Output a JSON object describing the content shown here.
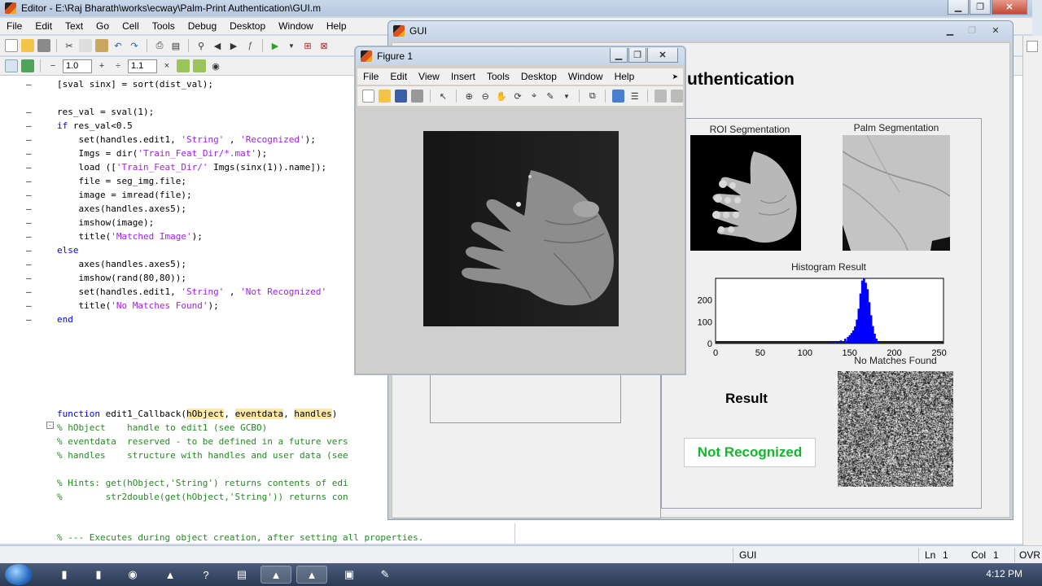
{
  "editor": {
    "title": "Editor - E:\\Raj Bharath\\works\\ecway\\Palm-Print Authentication\\GUI.m",
    "menu": [
      "File",
      "Edit",
      "Text",
      "Go",
      "Cell",
      "Tools",
      "Debug",
      "Desktop",
      "Window",
      "Help"
    ],
    "cell_minus": "−",
    "cell_value1": "1.0",
    "cell_plus": "+",
    "cell_divide": "÷",
    "cell_value2": "1.1",
    "cell_times": "×",
    "code": {
      "l1": "[sval sinx] = sort(dist_val);",
      "l2": "res_val = sval(1);",
      "l3_kw": "if",
      "l3_rest": " res_val<0.5",
      "l4_a": "    set(handles.edit1, ",
      "l4_s1": "'String'",
      "l4_b": " , ",
      "l4_s2": "'Recognized'",
      "l4_c": ");",
      "l5_a": "    Imgs = dir(",
      "l5_s": "'Train_Feat_Dir/*.mat'",
      "l5_b": ");",
      "l6_a": "    load ([",
      "l6_s": "'Train_Feat_Dir/'",
      "l6_b": " Imgs(sinx(1)).name]);",
      "l7": "    file = seg_img.file;",
      "l8": "    image = imread(file);",
      "l9": "    axes(handles.axes5);",
      "l10": "    imshow(image);",
      "l11_a": "    title(",
      "l11_s": "'Matched Image'",
      "l11_b": ");",
      "l12_kw": "else",
      "l13": "    axes(handles.axes5);",
      "l14": "    imshow(rand(80,80));",
      "l15_a": "    set(handles.edit1, ",
      "l15_s1": "'String'",
      "l15_b": " , ",
      "l15_s2": "'Not Recognized'",
      "l16_a": "    title(",
      "l16_s": "'No Matches Found'",
      "l16_b": ");",
      "l17_kw": "end",
      "f1_kw": "function",
      "f1_a": " edit1_Callback(",
      "f1_p1": "hObject",
      "f1_c1": ", ",
      "f1_p2": "eventdata",
      "f1_c2": ", ",
      "f1_p3": "handles",
      "f1_b": ")",
      "c1": "% hObject    handle to edit1 (see GCBO)",
      "c2": "% eventdata  reserved - to be defined in a future vers",
      "c3": "% handles    structure with handles and user data (see",
      "c4": "% Hints: get(hObject,'String') returns contents of edi",
      "c5": "%        str2double(get(hObject,'String')) returns con",
      "c6": "% --- Executes during object creation, after setting all properties."
    }
  },
  "status": {
    "file": "GUI",
    "ln_label": "Ln",
    "ln": "1",
    "col_label": "Col",
    "col": "1",
    "mode": "OVR"
  },
  "gui": {
    "title": "GUI",
    "heading": "uthentication",
    "roi_title": "ROI Segmentation",
    "palm_title": "Palm Segmentation",
    "hist_title": "Histogram Result",
    "hist_y_ticks": [
      "200",
      "100",
      "0"
    ],
    "hist_x_ticks": [
      "0",
      "50",
      "100",
      "150",
      "200",
      "250"
    ],
    "result_label": "Result",
    "result_value": "Not Recognized",
    "noise_title": "No Matches Found",
    "stray_label": "t"
  },
  "figure": {
    "title": "Figure 1",
    "menu": [
      "File",
      "Edit",
      "View",
      "Insert",
      "Tools",
      "Desktop",
      "Window",
      "Help"
    ]
  },
  "taskbar": {
    "clock": "4:12 PM"
  },
  "colors": {
    "keyword": "#0000ff",
    "string": "#a020f0",
    "comment": "#228b22",
    "result_text": "#12b82c",
    "histogram": "#0000ff"
  },
  "chart_data": {
    "type": "bar",
    "title": "Histogram Result",
    "xlim": [
      0,
      255
    ],
    "ylim": [
      0,
      300
    ],
    "x": [
      130,
      135,
      140,
      145,
      148,
      150,
      152,
      154,
      156,
      158,
      160,
      162,
      164,
      166,
      168,
      170,
      172,
      174,
      176,
      178,
      180,
      182,
      185
    ],
    "values": [
      4,
      8,
      14,
      22,
      30,
      38,
      48,
      60,
      78,
      110,
      160,
      230,
      290,
      300,
      280,
      250,
      190,
      130,
      80,
      45,
      22,
      10,
      3
    ]
  }
}
